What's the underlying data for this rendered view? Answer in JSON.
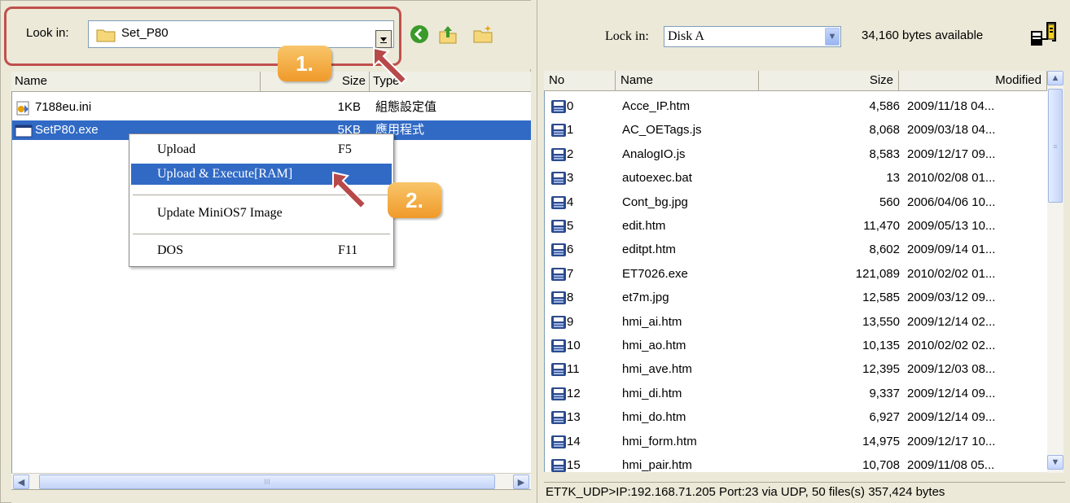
{
  "left": {
    "look_in_label": "Look in:",
    "look_in_value": "Set_P80",
    "columns": {
      "name": "Name",
      "size": "Size",
      "type": "Type"
    },
    "files": [
      {
        "name": "7188eu.ini",
        "size": "1KB",
        "type": "組態設定值",
        "icon": "ini-file-icon"
      },
      {
        "name": "SetP80.exe",
        "size": "5KB",
        "type": "應用程式",
        "icon": "exe-file-icon"
      }
    ],
    "scroll_thumb_grip": "III"
  },
  "context_menu": {
    "items": [
      {
        "label": "Upload",
        "shortcut": "F5"
      },
      {
        "label": "Upload & Execute[RAM]",
        "shortcut": ""
      },
      {
        "label": "Update MiniOS7 Image",
        "shortcut": ""
      },
      {
        "label": "DOS",
        "shortcut": "F11"
      }
    ]
  },
  "annotations": {
    "step1": "1.",
    "step2": "2.",
    "accent": "#c0504d",
    "badge_color": "#f0a030"
  },
  "right": {
    "look_in_label": "Lock in:",
    "look_in_value": "Disk A",
    "bytes_available": "34,160 bytes available",
    "columns": {
      "no": "No",
      "name": "Name",
      "size": "Size",
      "modified": "Modified"
    },
    "files": [
      {
        "no": "0",
        "name": "Acce_IP.htm",
        "size": "4,586",
        "modified": "2009/11/18 04..."
      },
      {
        "no": "1",
        "name": "AC_OETags.js",
        "size": "8,068",
        "modified": "2009/03/18 04..."
      },
      {
        "no": "2",
        "name": "AnalogIO.js",
        "size": "8,583",
        "modified": "2009/12/17 09..."
      },
      {
        "no": "3",
        "name": "autoexec.bat",
        "size": "13",
        "modified": "2010/02/08 01..."
      },
      {
        "no": "4",
        "name": "Cont_bg.jpg",
        "size": "560",
        "modified": "2006/04/06 10..."
      },
      {
        "no": "5",
        "name": "edit.htm",
        "size": "11,470",
        "modified": "2009/05/13 10..."
      },
      {
        "no": "6",
        "name": "editpt.htm",
        "size": "8,602",
        "modified": "2009/09/14 01..."
      },
      {
        "no": "7",
        "name": "ET7026.exe",
        "size": "121,089",
        "modified": "2010/02/02 01..."
      },
      {
        "no": "8",
        "name": "et7m.jpg",
        "size": "12,585",
        "modified": "2009/03/12 09..."
      },
      {
        "no": "9",
        "name": "hmi_ai.htm",
        "size": "13,550",
        "modified": "2009/12/14 02..."
      },
      {
        "no": "10",
        "name": "hmi_ao.htm",
        "size": "10,135",
        "modified": "2010/02/02 02..."
      },
      {
        "no": "11",
        "name": "hmi_ave.htm",
        "size": "12,395",
        "modified": "2009/12/03 08..."
      },
      {
        "no": "12",
        "name": "hmi_di.htm",
        "size": "9,337",
        "modified": "2009/12/14 09..."
      },
      {
        "no": "13",
        "name": "hmi_do.htm",
        "size": "6,927",
        "modified": "2009/12/14 09..."
      },
      {
        "no": "14",
        "name": "hmi_form.htm",
        "size": "14,975",
        "modified": "2009/12/17 10..."
      },
      {
        "no": "15",
        "name": "hmi_pair.htm",
        "size": "10,708",
        "modified": "2009/11/08 05..."
      }
    ],
    "status": "ET7K_UDP>IP:192.168.71.205 Port:23 via UDP, 50 files(s) 357,424 bytes",
    "scroll_thumb_grip": "≡"
  }
}
